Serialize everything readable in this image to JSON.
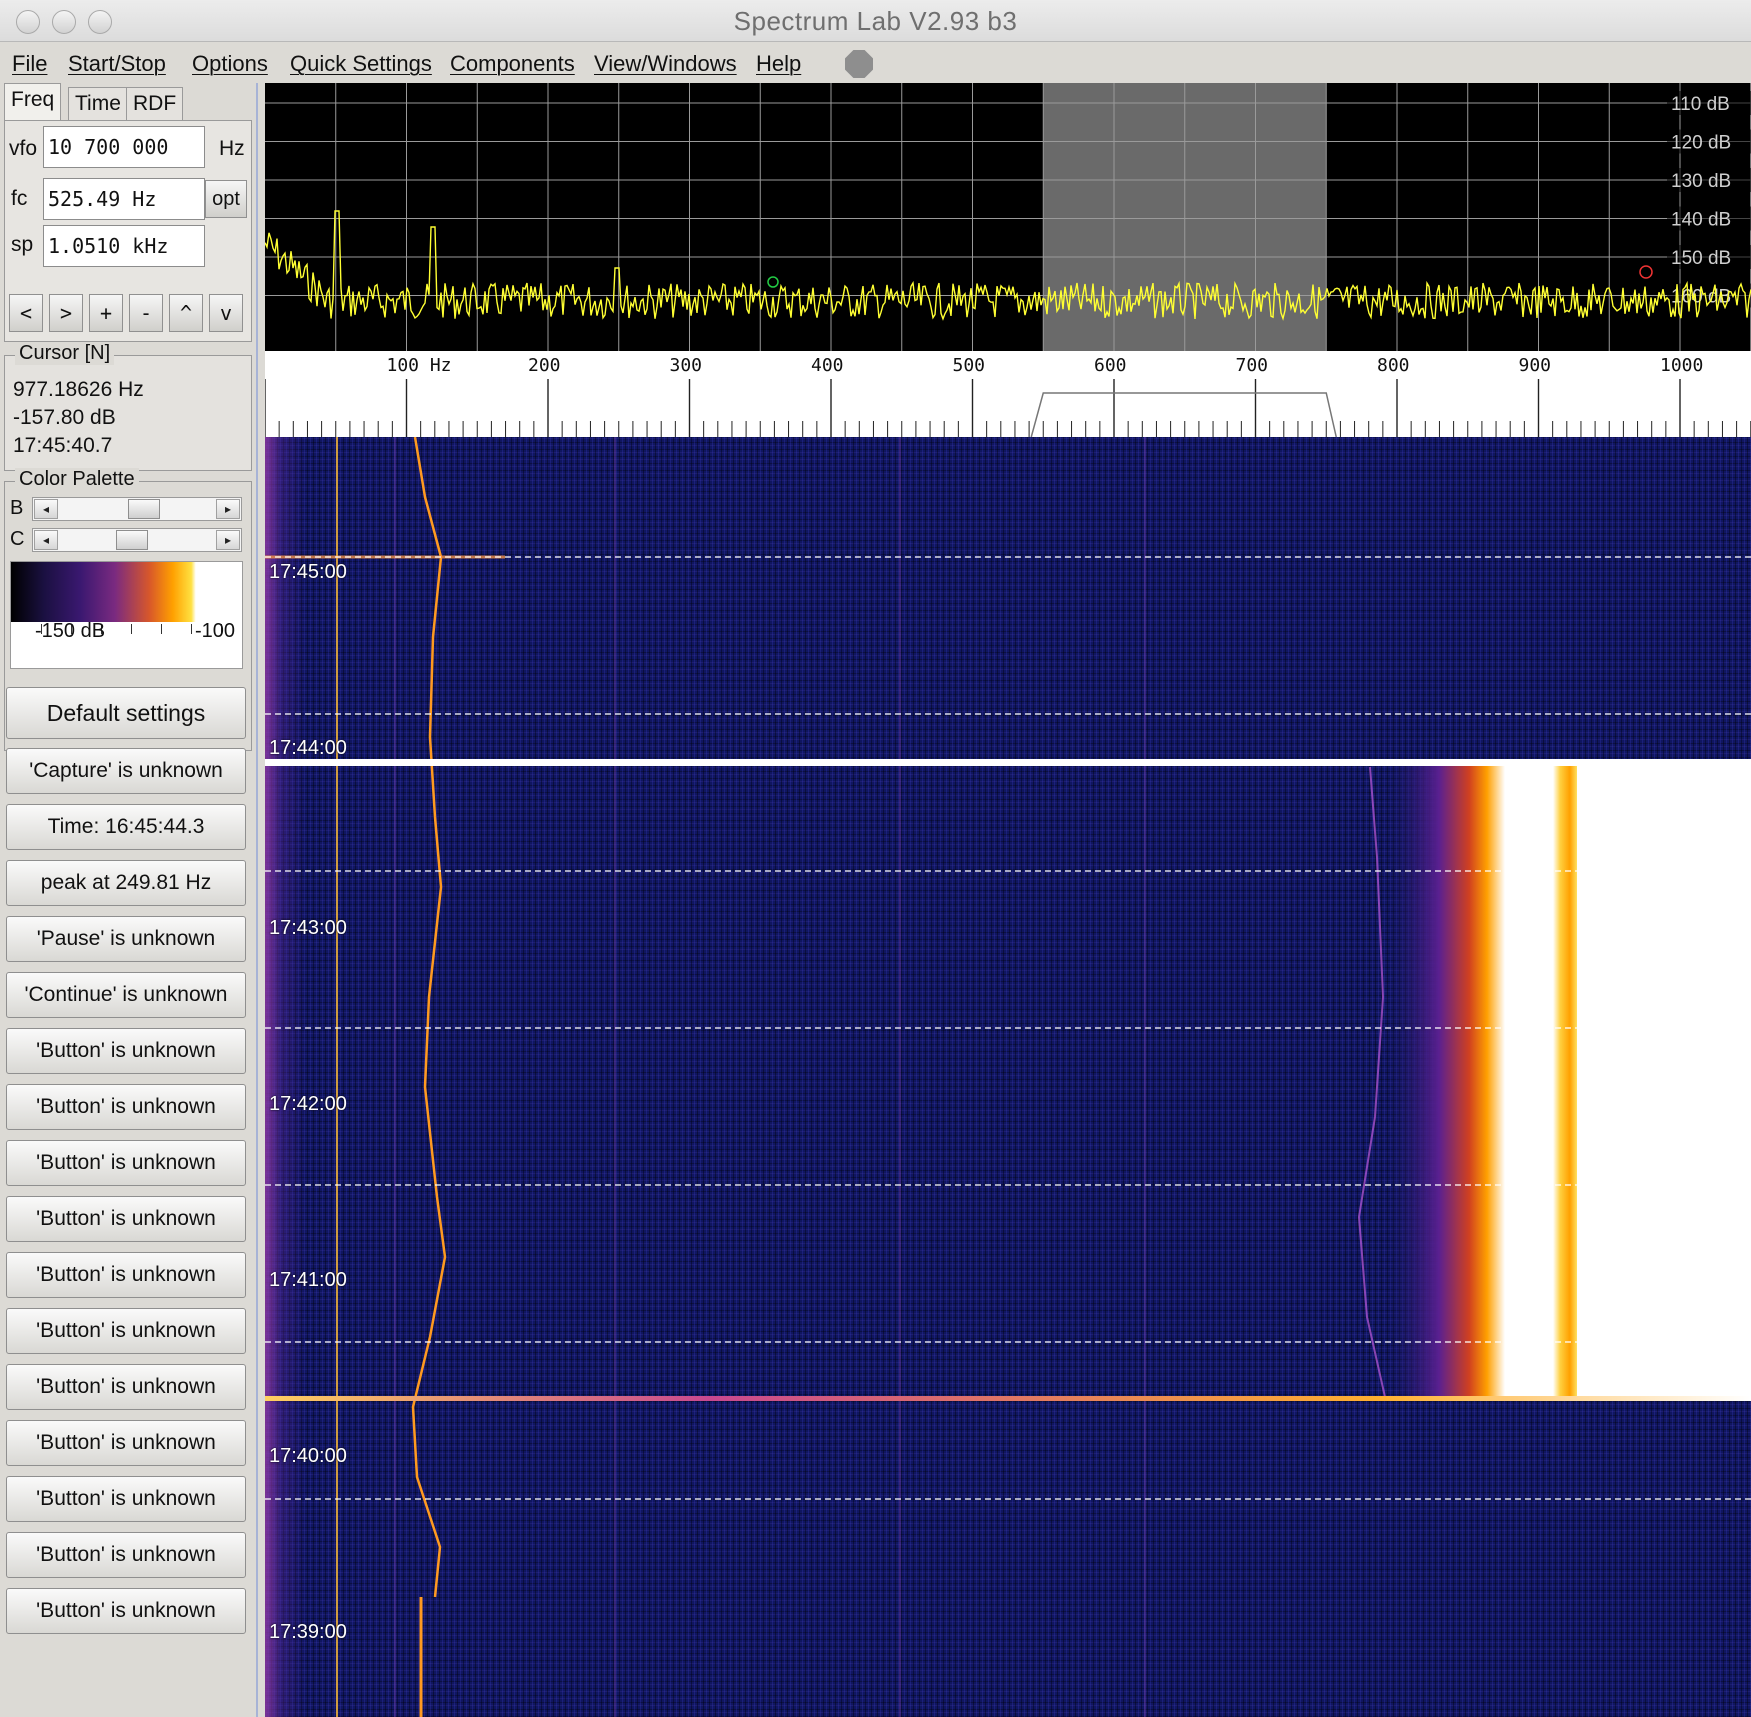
{
  "window": {
    "title": "Spectrum Lab V2.93 b3"
  },
  "menu": [
    "File",
    "Start/Stop",
    "Options",
    "Quick Settings",
    "Components",
    "View/Windows",
    "Help"
  ],
  "tabs": [
    "Freq",
    "Time",
    "RDF"
  ],
  "freq_panel": {
    "vfo_label": "vfo",
    "vfo_value": "10 700 000",
    "vfo_unit": "Hz",
    "fc_label": "fc",
    "fc_value": "525.49 Hz",
    "opt_label": "opt",
    "sp_label": "sp",
    "sp_value": "1.0510 kHz",
    "scroll_buttons": [
      "<",
      ">",
      "+",
      "-",
      "^",
      "v"
    ]
  },
  "cursor": {
    "title": "Cursor [N]",
    "freq": "977.18626 Hz",
    "level": "-157.80 dB",
    "time": "17:45:40.7"
  },
  "palette": {
    "title": "Color Palette",
    "b_label": "B",
    "c_label": "C",
    "left_label": "-150 dB",
    "right_label": "-100",
    "b_level": 0.55,
    "c_level": 0.45
  },
  "buttons": {
    "default": "Default settings",
    "capture": "'Capture' is unknown",
    "time": "Time:  16:45:44.3",
    "peak": "peak at 249.81 Hz",
    "pause": "'Pause' is unknown",
    "continue": "'Continue' is unknown",
    "generic": [
      "'Button' is unknown",
      "'Button' is unknown",
      "'Button' is unknown",
      "'Button' is unknown",
      "'Button' is unknown",
      "'Button' is unknown",
      "'Button' is unknown",
      "'Button' is unknown",
      "'Button' is unknown",
      "'Button' is unknown",
      "'Button' is unknown"
    ]
  },
  "spectrum": {
    "db_labels": [
      "110 dB",
      "120 dB",
      "130 dB",
      "140 dB",
      "150 dB",
      "160 dB"
    ],
    "freq_labels": [
      "100 Hz",
      "200",
      "300",
      "400",
      "500",
      "600",
      "700",
      "800",
      "900",
      "1000"
    ],
    "trace_color": "#ffff33",
    "passband_hz": [
      550,
      750
    ]
  },
  "waterfall": {
    "time_labels": [
      "17:45:00",
      "17:44:00",
      "17:43:00",
      "17:42:00",
      "17:41:00",
      "17:40:00",
      "17:39:00"
    ]
  }
}
